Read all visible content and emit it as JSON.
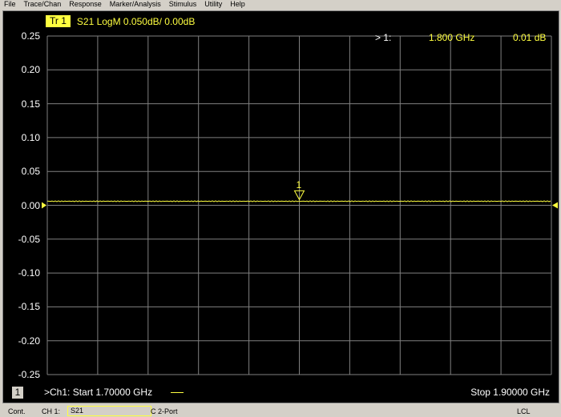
{
  "menu": [
    "File",
    "Trace/Chan",
    "Response",
    "Marker/Analysis",
    "Stimulus",
    "Utility",
    "Help"
  ],
  "trace": {
    "badge": "Tr 1",
    "label": "S21 LogM 0.050dB/  0.00dB",
    "color": "#ffff40"
  },
  "y_ticks": [
    "0.25",
    "0.20",
    "0.15",
    "0.10",
    "0.05",
    "0.00",
    "-0.05",
    "-0.10",
    "-0.15",
    "-0.20",
    "-0.25"
  ],
  "marker": {
    "number": "1",
    "readout_label": "> 1:",
    "freq": "1.800 GHz",
    "value": "0.01 dB",
    "freq_ghz": 1.8,
    "value_db": 0.006
  },
  "footer": {
    "channel_number": "1",
    "start": ">Ch1: Start  1.70000 GHz",
    "stop": "Stop  1.90000 GHz"
  },
  "status": {
    "mode": "Cont.",
    "channel": "CH 1:",
    "measurement": "S21",
    "cal": "C  2-Port",
    "remote": "LCL"
  },
  "chart_data": {
    "type": "line",
    "x_range_ghz": [
      1.7,
      1.9
    ],
    "ylim": [
      -0.25,
      0.25
    ],
    "y_per_div": 0.05,
    "reference": 0.0,
    "series": [
      {
        "name": "S21",
        "level_db": 0.006
      }
    ]
  }
}
